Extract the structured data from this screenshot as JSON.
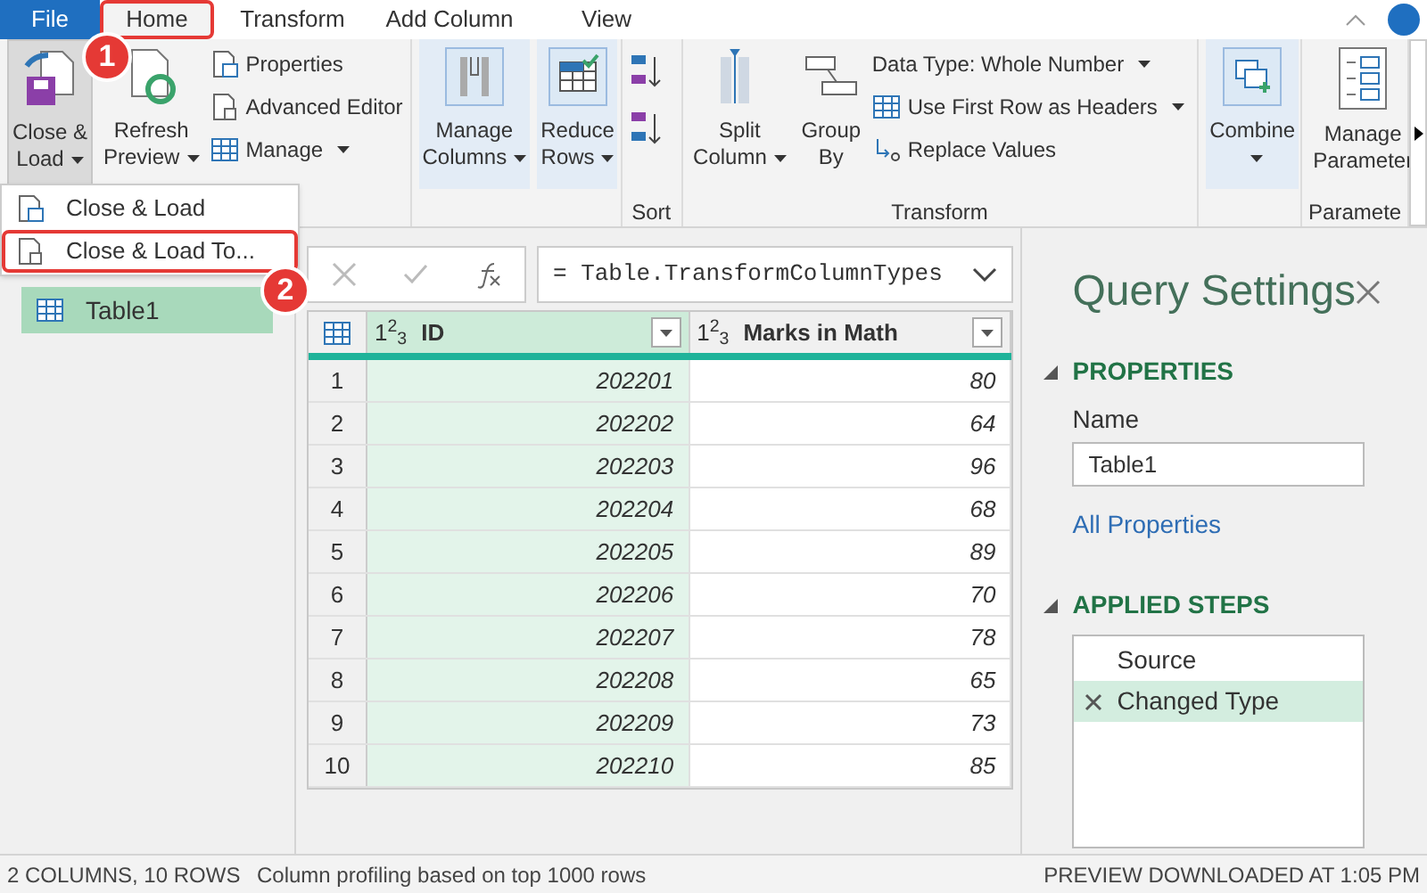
{
  "ribbon_tabs": [
    {
      "kind": "file",
      "label": "File",
      "selected": false
    },
    {
      "kind": "tab",
      "label": "Home",
      "selected": true
    },
    {
      "kind": "tab",
      "label": "Transform",
      "selected": false
    },
    {
      "kind": "tab",
      "label": "Add Column",
      "selected": false
    },
    {
      "kind": "tab",
      "label": "View",
      "selected": false
    }
  ],
  "ribbon_groups": [
    {
      "items": [
        {
          "kind": "large",
          "lines": [
            "Close &",
            "Load"
          ],
          "dropdown": true,
          "pressed": true,
          "highlighted": false
        }
      ]
    },
    {
      "items": [
        {
          "kind": "large",
          "lines": [
            "Refresh",
            "Preview"
          ],
          "dropdown": true,
          "pressed": false,
          "highlighted": false
        },
        {
          "kind": "stack",
          "items": [
            {
              "label": "Properties",
              "dropdown": false
            },
            {
              "label": "Advanced Editor",
              "dropdown": false
            },
            {
              "label": "Manage",
              "dropdown": true
            }
          ]
        }
      ]
    },
    {
      "items": [
        {
          "kind": "large",
          "lines": [
            "Manage",
            "Columns"
          ],
          "dropdown": true,
          "pressed": false,
          "highlighted": true
        },
        {
          "kind": "large",
          "lines": [
            "Reduce",
            "Rows"
          ],
          "dropdown": true,
          "pressed": false,
          "highlighted": true
        }
      ]
    },
    {
      "label": "Sort",
      "items": [
        {
          "kind": "sort"
        }
      ]
    },
    {
      "label": "Transform",
      "items": [
        {
          "kind": "large",
          "lines": [
            "Split",
            "Column"
          ],
          "dropdown": true,
          "pressed": false,
          "highlighted": false
        },
        {
          "kind": "large",
          "lines": [
            "Group",
            "By"
          ],
          "dropdown": false,
          "pressed": false,
          "highlighted": false
        },
        {
          "kind": "stack",
          "items": [
            {
              "label": "Data Type: Whole Number",
              "dropdown": true
            },
            {
              "label": "Use First Row as Headers",
              "dropdown": true
            },
            {
              "label": "Replace Values",
              "dropdown": false
            }
          ]
        }
      ]
    },
    {
      "items": [
        {
          "kind": "large",
          "lines": [
            "Combine"
          ],
          "dropdown": true,
          "pressed": false,
          "highlighted": true
        }
      ]
    },
    {
      "label": "Paramete",
      "items": [
        {
          "kind": "large",
          "lines": [
            "Manage",
            "Parameter"
          ],
          "dropdown": false,
          "pressed": false,
          "highlighted": false
        }
      ]
    }
  ],
  "menu": {
    "items": [
      {
        "label": "Close & Load",
        "selected": false
      },
      {
        "label": "Close & Load To...",
        "selected": true
      }
    ]
  },
  "callouts": [
    "1",
    "2"
  ],
  "queries": [
    {
      "name": "Table1",
      "selected": true
    }
  ],
  "formula": "= Table.TransformColumnTypes",
  "table": {
    "columns": [
      {
        "type": "1$^{2}$$_{3}$",
        "label": "ID",
        "selected": true
      },
      {
        "type": "1$^{2}$$_{3}$",
        "label": "Marks in Math",
        "selected": false
      }
    ],
    "rows": [
      [
        "1",
        "202201",
        "80"
      ],
      [
        "2",
        "202202",
        "64"
      ],
      [
        "3",
        "202203",
        "96"
      ],
      [
        "4",
        "202204",
        "68"
      ],
      [
        "5",
        "202205",
        "89"
      ],
      [
        "6",
        "202206",
        "70"
      ],
      [
        "7",
        "202207",
        "78"
      ],
      [
        "8",
        "202208",
        "65"
      ],
      [
        "9",
        "202209",
        "73"
      ],
      [
        "10",
        "202210",
        "85"
      ]
    ]
  },
  "query_settings": {
    "title": "Query Settings",
    "properties_heading": "PROPERTIES",
    "name_label": "Name",
    "name_value": "Table1",
    "all_properties": "All Properties",
    "steps_heading": "APPLIED STEPS",
    "steps": [
      {
        "label": "Source",
        "selected": false
      },
      {
        "label": "Changed Type",
        "selected": true
      }
    ]
  },
  "status_bar": {
    "columns_rows": "2 COLUMNS, 10 ROWS",
    "profiling": "Column profiling based on top 1000 rows",
    "preview": "PREVIEW DOWNLOADED AT 1:05 PM"
  }
}
